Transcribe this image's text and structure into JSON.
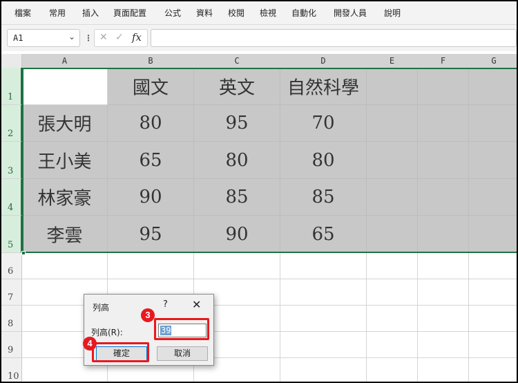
{
  "menu": [
    "檔案",
    "常用",
    "插入",
    "頁面配置",
    "公式",
    "資料",
    "校閱",
    "檢視",
    "自動化",
    "開發人員",
    "說明"
  ],
  "formula_bar": {
    "name_box": "A1",
    "name_box_arrow_icon": "chevron-down-icon",
    "separator": "⋮",
    "cancel_icon": "✕",
    "enter_icon": "✓",
    "fx_label": "fx",
    "formula": ""
  },
  "columns": [
    "A",
    "B",
    "C",
    "D",
    "E",
    "F",
    "G"
  ],
  "rows": [
    "1",
    "2",
    "3",
    "4",
    "5",
    "6",
    "7",
    "8",
    "9",
    "10"
  ],
  "table": {
    "headers": [
      "",
      "國文",
      "英文",
      "自然科學"
    ],
    "rows": [
      {
        "name": "張大明",
        "values": [
          "80",
          "95",
          "70"
        ]
      },
      {
        "name": "王小美",
        "values": [
          "65",
          "80",
          "80"
        ]
      },
      {
        "name": "林家豪",
        "values": [
          "90",
          "85",
          "85"
        ]
      },
      {
        "name": "李雲",
        "values": [
          "95",
          "90",
          "65"
        ]
      }
    ]
  },
  "dialog": {
    "title": "列高",
    "help": "?",
    "close": "✕",
    "label": "列高(R):",
    "value": "39",
    "ok_label": "確定",
    "cancel_label": "取消"
  },
  "annotations": {
    "step3": "3",
    "step4": "4",
    "color": "#e8191f"
  },
  "colors": {
    "selection": "#1e7145",
    "shaded_cells": "#c8c8c8"
  }
}
